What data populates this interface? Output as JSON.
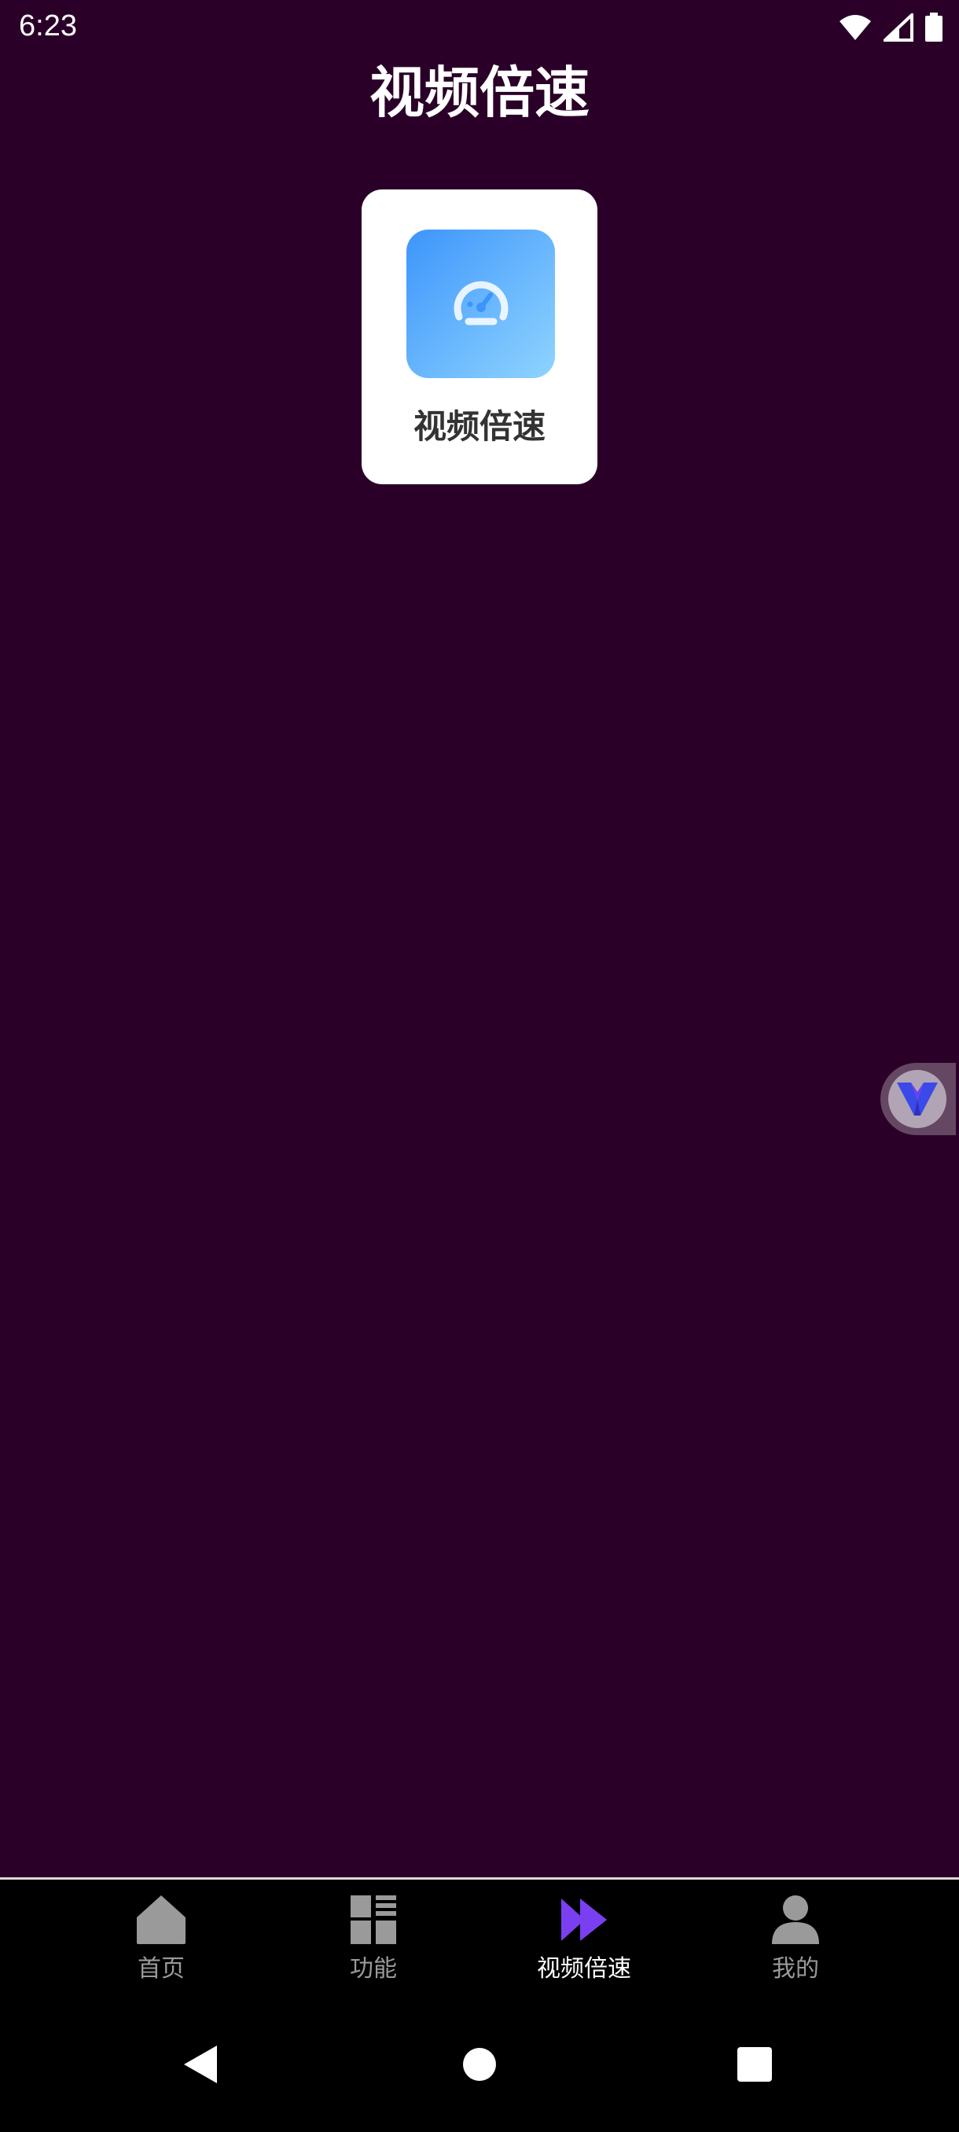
{
  "status_bar": {
    "time": "6:23"
  },
  "page": {
    "title": "视频倍速"
  },
  "feature_card": {
    "label": "视频倍速",
    "icon": "speedometer-icon",
    "gradient_start": "#3d95fb",
    "gradient_end": "#8fd4ff"
  },
  "floating_bubble": {
    "icon": "v-logo-icon"
  },
  "bottom_nav": {
    "items": [
      {
        "label": "首页",
        "icon": "home-icon",
        "active": false
      },
      {
        "label": "功能",
        "icon": "grid-list-icon",
        "active": false
      },
      {
        "label": "视频倍速",
        "icon": "fast-forward-icon",
        "active": true
      },
      {
        "label": "我的",
        "icon": "person-icon",
        "active": false
      }
    ]
  },
  "colors": {
    "background": "#2a0029",
    "active_accent": "#7b3ff2",
    "inactive_icon": "#9a9a9a",
    "nav_background": "#000000"
  },
  "system_nav": {
    "buttons": [
      "back-icon",
      "home-circle-icon",
      "recents-icon"
    ]
  }
}
